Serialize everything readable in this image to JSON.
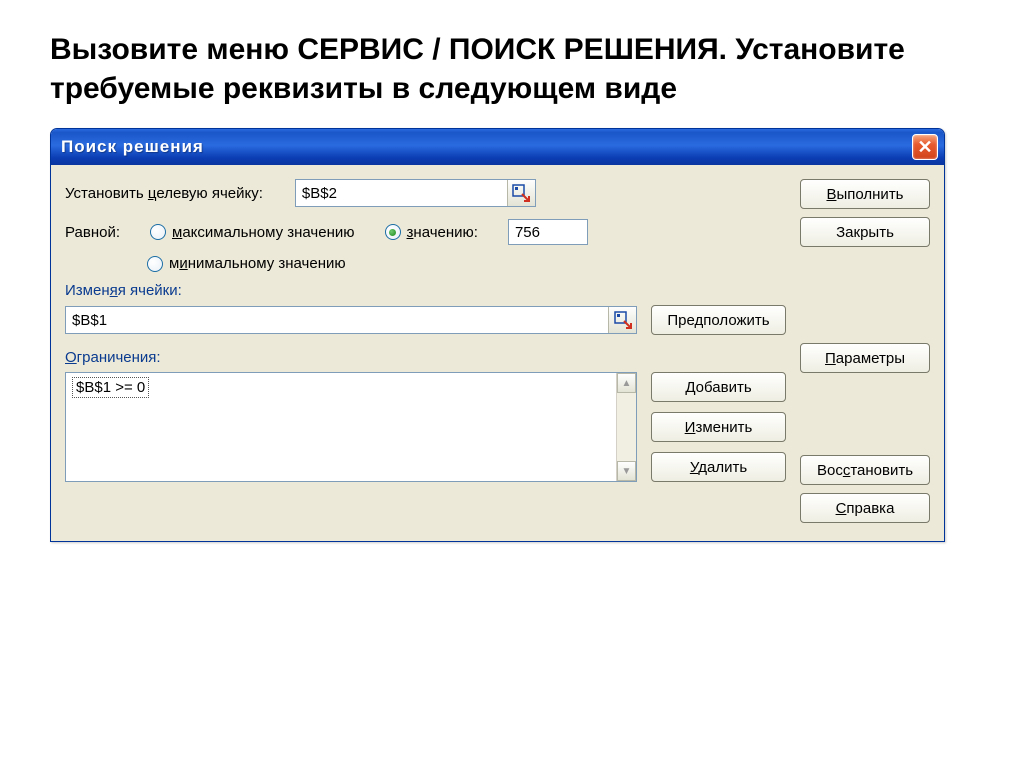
{
  "instruction": "Вызовите меню СЕРВИС / ПОИСК РЕШЕНИЯ. Установите требуемые реквизиты в следующем виде",
  "dialog": {
    "title": "Поиск решения",
    "target_cell": {
      "label": "Установить целевую ячейку:",
      "value": "$B$2"
    },
    "equal_to_label": "Равной:",
    "radio_max": "максимальному значению",
    "radio_value": "значению:",
    "radio_min": "минимальному значению",
    "value_input": "756",
    "changing_label": "Изменяя ячейки:",
    "changing_value": "$B$1",
    "guess_btn": "Предположить",
    "constraints_label": "Ограничения:",
    "constraints": [
      "$B$1 >= 0"
    ],
    "btn_add": "Добавить",
    "btn_change": "Изменить",
    "btn_delete": "Удалить",
    "btn_execute": "Выполнить",
    "btn_close": "Закрыть",
    "btn_params": "Параметры",
    "btn_restore": "Восстановить",
    "btn_help": "Справка"
  }
}
